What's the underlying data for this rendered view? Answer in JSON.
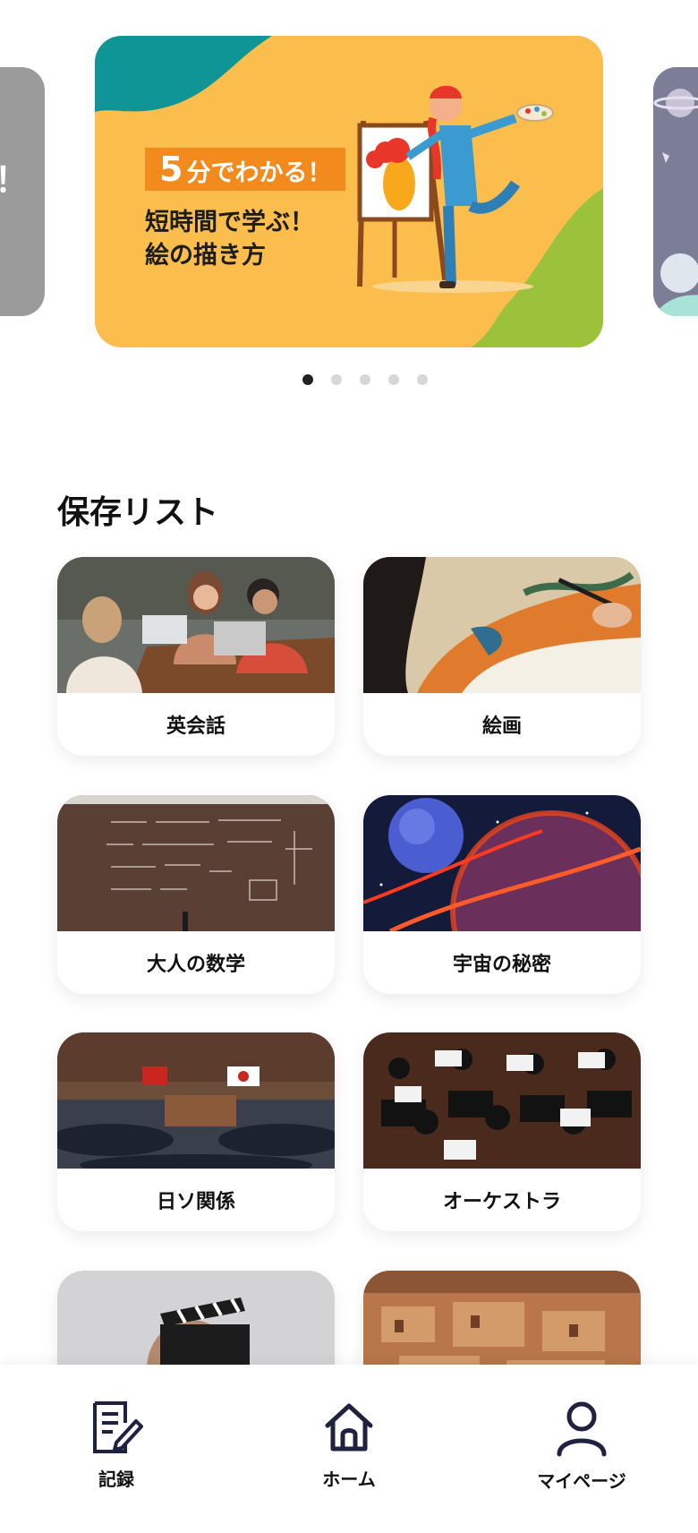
{
  "carousel": {
    "peek_left_text": "紀！",
    "slide": {
      "badge_number": "5",
      "badge_text": "分でわかる！",
      "headline_line1": "短時間で学ぶ！",
      "headline_line2": "絵の描き方"
    },
    "dots_count": 5,
    "active_dot": 0
  },
  "saved_list": {
    "title": "保存リスト",
    "items": [
      {
        "label": "英会話"
      },
      {
        "label": "絵画"
      },
      {
        "label": "大人の数学"
      },
      {
        "label": "宇宙の秘密"
      },
      {
        "label": "日ソ関係"
      },
      {
        "label": "オーケストラ"
      },
      {
        "label": ""
      },
      {
        "label": ""
      }
    ]
  },
  "nav": {
    "records": {
      "label": "記録",
      "icon": "document-pen-icon"
    },
    "home": {
      "label": "ホーム",
      "icon": "home-icon"
    },
    "mypage": {
      "label": "マイページ",
      "icon": "person-icon"
    }
  },
  "colors": {
    "slide_bg": "#fbbd4c",
    "slide_teal": "#0f9596",
    "slide_green": "#9bc23a",
    "badge_orange": "#f38a1e",
    "nav_icon": "#1e2140",
    "dot_active": "#222222",
    "dot_inactive": "#d6d6d6"
  }
}
